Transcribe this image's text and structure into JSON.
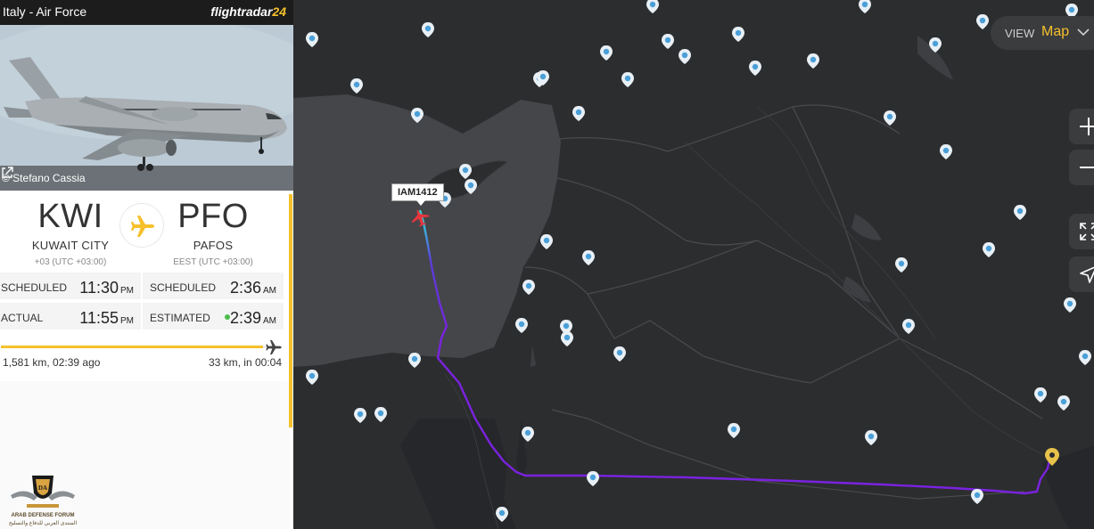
{
  "header": {
    "title": "Italy - Air Force",
    "logo_text": "flightradar",
    "logo_number": "24"
  },
  "photo": {
    "credit": "© Stefano Cassia"
  },
  "route": {
    "origin": {
      "code": "KWI",
      "city": "KUWAIT CITY",
      "tz": "+03 (UTC +03:00)"
    },
    "destination": {
      "code": "PFO",
      "city": "PAFOS",
      "tz": "EEST (UTC +03:00)"
    }
  },
  "times": {
    "scheduled_label": "SCHEDULED",
    "actual_label": "ACTUAL",
    "estimated_label": "ESTIMATED",
    "dep_scheduled": "11:30",
    "dep_scheduled_ampm": "PM",
    "dep_actual": "11:55",
    "dep_actual_ampm": "PM",
    "arr_scheduled": "2:36",
    "arr_scheduled_ampm": "AM",
    "arr_estimated": "2:39",
    "arr_estimated_ampm": "AM"
  },
  "progress": {
    "fraction": 0.98,
    "flown": "1,581 km, 02:39 ago",
    "remaining": "33 km, in 00:04"
  },
  "watermark": {
    "line1": "ARAB DEFENSE FORUM",
    "line2": "المنتدى العربي للدفاع والتسليح"
  },
  "map": {
    "view_label": "VIEW",
    "view_value": "Map",
    "flight_callsign": "IAM1412"
  },
  "colors": {
    "accent": "#f5c02b",
    "track_start": "#3ad0d0",
    "track_end": "#7a22e0",
    "aircraft": "#e8353d"
  },
  "icons": [
    "external-link-icon",
    "airplane-icon",
    "zoom-in-icon",
    "zoom-out-icon",
    "fullscreen-icon",
    "locate-icon",
    "chevron-down-icon",
    "airport-pin-icon"
  ]
}
